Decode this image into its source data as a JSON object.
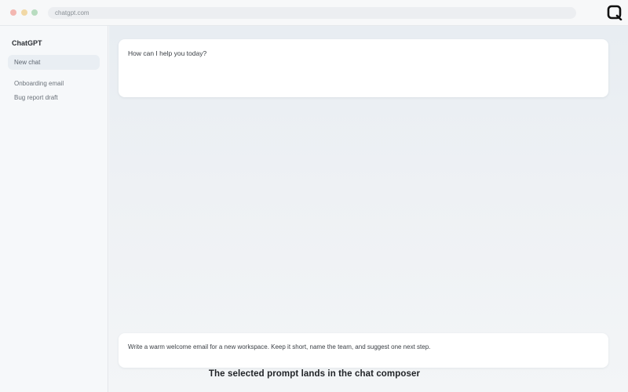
{
  "browser": {
    "url": "chatgpt.com",
    "brand_icon": "square-logo-icon"
  },
  "sidebar": {
    "title": "ChatGPT",
    "items": [
      {
        "label": "New chat",
        "active": true
      },
      {
        "label": "Onboarding email",
        "active": false
      },
      {
        "label": "Bug report draft",
        "active": false
      }
    ]
  },
  "main": {
    "greeting": "How can I help you today?",
    "composer_text": "Write a warm welcome email for a new workspace. Keep it short, name the team, and suggest one next step.",
    "caption": "The selected prompt lands in the chat composer"
  },
  "colors": {
    "dot_red": "#f3b7b1",
    "dot_yellow": "#f1d8a6",
    "dot_green": "#b8dcc0",
    "active_item_bg": "#e9eef3"
  }
}
